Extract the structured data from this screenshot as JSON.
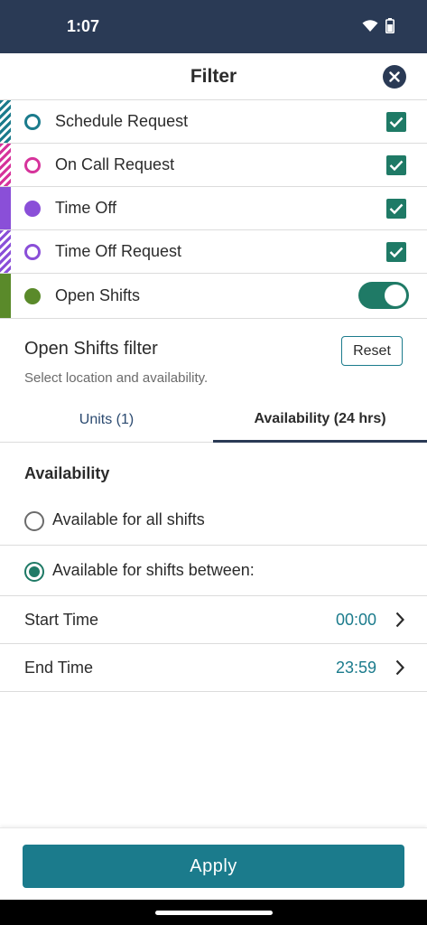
{
  "status_bar": {
    "time": "1:07"
  },
  "header": {
    "title": "Filter"
  },
  "categories": [
    {
      "label": "Schedule Request",
      "color": "#1b7b8c",
      "stripe": "hatched",
      "dot": "hollow",
      "checked": true
    },
    {
      "label": "On Call Request",
      "color": "#d6339b",
      "stripe": "hatched",
      "dot": "hollow",
      "checked": true
    },
    {
      "label": "Time Off",
      "color": "#8a4fd8",
      "stripe": "solid",
      "dot": "filled",
      "checked": true
    },
    {
      "label": "Time Off Request",
      "color": "#8a4fd8",
      "stripe": "hatched",
      "dot": "hollow",
      "checked": true
    },
    {
      "label": "Open Shifts",
      "color": "#5a8a2a",
      "stripe": "solid",
      "dot": "filled",
      "toggle_on": true
    }
  ],
  "open_shifts_filter": {
    "title": "Open Shifts filter",
    "subtitle": "Select location and availability.",
    "reset_label": "Reset"
  },
  "tabs": [
    {
      "label": "Units (1)",
      "active": false
    },
    {
      "label": "Availability (24 hrs)",
      "active": true
    }
  ],
  "availability": {
    "section_title": "Availability",
    "options": [
      {
        "label": "Available for all shifts",
        "selected": false
      },
      {
        "label": "Available for shifts between:",
        "selected": true
      }
    ],
    "start_time": {
      "label": "Start Time",
      "value": "00:00"
    },
    "end_time": {
      "label": "End Time",
      "value": "23:59"
    }
  },
  "apply_label": "Apply",
  "colors": {
    "primary": "#1b7b8c",
    "dark": "#2a3a55",
    "check": "#1f7a66"
  }
}
